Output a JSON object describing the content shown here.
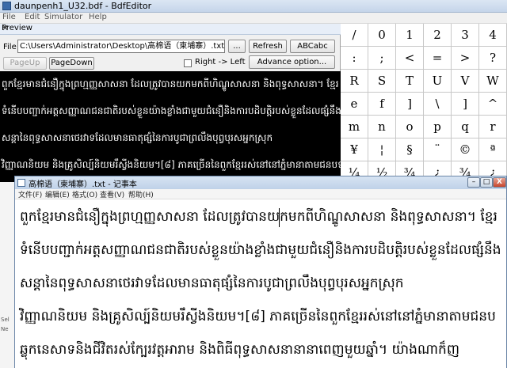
{
  "bdf": {
    "title": "daunpenh1_U32.bdf - BdfEditor",
    "menu": [
      "File",
      "Edit",
      "Simulator",
      "Help"
    ],
    "glyphs": [
      [
        "/",
        "0",
        "1",
        "2",
        "3",
        "4"
      ],
      [
        ":",
        ";",
        "<",
        "=",
        ">",
        "?"
      ],
      [
        "R",
        "S",
        "T",
        "U",
        "V",
        "W"
      ],
      [
        "e",
        "f",
        "]",
        "\\",
        "]",
        "^"
      ],
      [
        "m",
        "n",
        "o",
        "p",
        "q",
        "r"
      ],
      [
        "¥",
        "¦",
        "§",
        "¨",
        "©",
        "ª"
      ],
      [
        "¼",
        "½",
        "¾",
        "¿",
        "¾",
        "¿"
      ]
    ],
    "left_edge_text": [
      "Sel",
      "Ne"
    ]
  },
  "preview": {
    "title": "Preview",
    "file_label": "File",
    "file_path": "C:\\Users\\Administrator\\Desktop\\高棉语（柬埔寨）.txt",
    "browse_label": "...",
    "refresh_label": "Refresh",
    "abcabc_label": "ABCabc",
    "pageup_label": "PageUp",
    "pagedown_label": "PageDown",
    "rtl_label": "Right -> Left",
    "advance_label": "Advance option...",
    "lines": [
      "ពួកខ្មែរមានជំនឿក្នុងព្រហ្មញ្ញសាសនា ដែលត្រូវបានយកមកពីហិណ្ឌូសាសនា និងពុទ្ធសាសនា។ ខ្មែរ",
      "ទំនើបបញ្ជាក់អត្តសញ្ញាណជនជាតិរបស់ខ្លួនយ៉ាងខ្លាំងជាមួយជំនឿនិងការបដិបត្តិរបស់ខ្លួនដែលផ្សំនឹង",
      "សន្តានៃពុទ្ធសាសនាថេរវាទដែលមានធាតុផ្សំនៃការបូជាព្រលឹងបុព្វបុរសអ្នកស្រុក",
      "វិញ្ញាណនិយម និងគ្រូសិល្ប៍និយមរឹស្វីងនិយម។[៨] ភាគច្រើននៃពួកខ្មែររស់នៅនៅភ្នំមានាតាមជនបទ"
    ]
  },
  "notepad": {
    "title": "高棉语（柬埔寨）.txt - 记事本",
    "menu": [
      "文件(F)",
      "编辑(E)",
      "格式(O)",
      "查看(V)",
      "帮助(H)"
    ],
    "min_label": "–",
    "max_label": "□",
    "close_label": "X",
    "lines": [
      "ពួកខ្មែរមានជំនឿក្នុងព្រហ្មញ្ញសាសនា ដែលត្រូវបានយកមកពីហិណ្ឌូសាសនា និងពុទ្ធសាសនា។ ខ្មែរ",
      "ទំនើបបញ្ជាក់អត្តសញ្ញាណជនជាតិរបស់ខ្លួនយ៉ាងខ្លាំងជាមួយជំនឿនិងការបដិបត្តិរបស់ខ្លួនដែលផ្សំនឹង",
      "សន្តានៃពុទ្ធសាសនាថេរវាទដែលមានធាតុផ្សំនៃការបូជាព្រលឹងបុព្វបុរសអ្នកស្រុក",
      "វិញ្ញាណនិយម និងគ្រូសិល្ប៍និយមរឹស្វីងនិយម។[៨] ភាគច្រើននៃពួកខ្មែររស់នៅនៅភ្នំមានាតាមជនប",
      "ឆ្លុកនេសាទនិងជីវិតរស់ក្បែរវត្តអារាម និងពិធីពុទ្ធសាសនានានាពេញមួយឆ្នាំ។ យ៉ាងណាក៏ញ"
    ]
  }
}
